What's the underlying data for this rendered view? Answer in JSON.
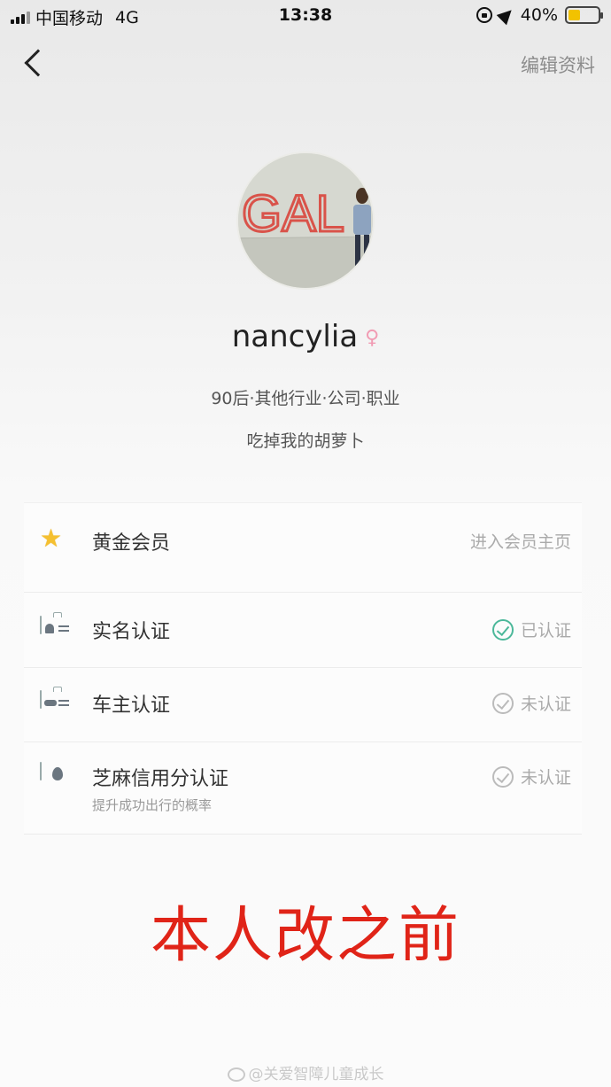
{
  "status_bar": {
    "carrier": "中国移动",
    "network": "4G",
    "time": "13:38",
    "battery": "40%",
    "battery_level": 0.4
  },
  "nav": {
    "back_icon": "chevron-left-icon",
    "edit_label": "编辑资料"
  },
  "profile": {
    "avatar_text": "GAL",
    "username": "nancylia",
    "gender_symbol": "♀",
    "tags": "90后·其他行业·公司·职业",
    "bio": "吃掉我的胡萝卜"
  },
  "list": [
    {
      "icon": "star-icon",
      "label": "黄金会员",
      "right": "进入会员主页"
    },
    {
      "icon": "id-card-icon",
      "label": "实名认证",
      "right": "已认证",
      "verified": true
    },
    {
      "icon": "car-card-icon",
      "label": "车主认证",
      "right": "未认证",
      "verified": false
    },
    {
      "icon": "sesame-credit-icon",
      "label": "芝麻信用分认证",
      "sub": "提升成功出行的概率",
      "right": "未认证",
      "verified": false
    }
  ],
  "overlay_caption": "本人改之前",
  "watermark": "@关爱智障儿童成长",
  "colors": {
    "caption_red": "#e02418",
    "verified_green": "#4cb89a",
    "star_gold": "#f5c030",
    "female_pink": "#f19bb3"
  }
}
